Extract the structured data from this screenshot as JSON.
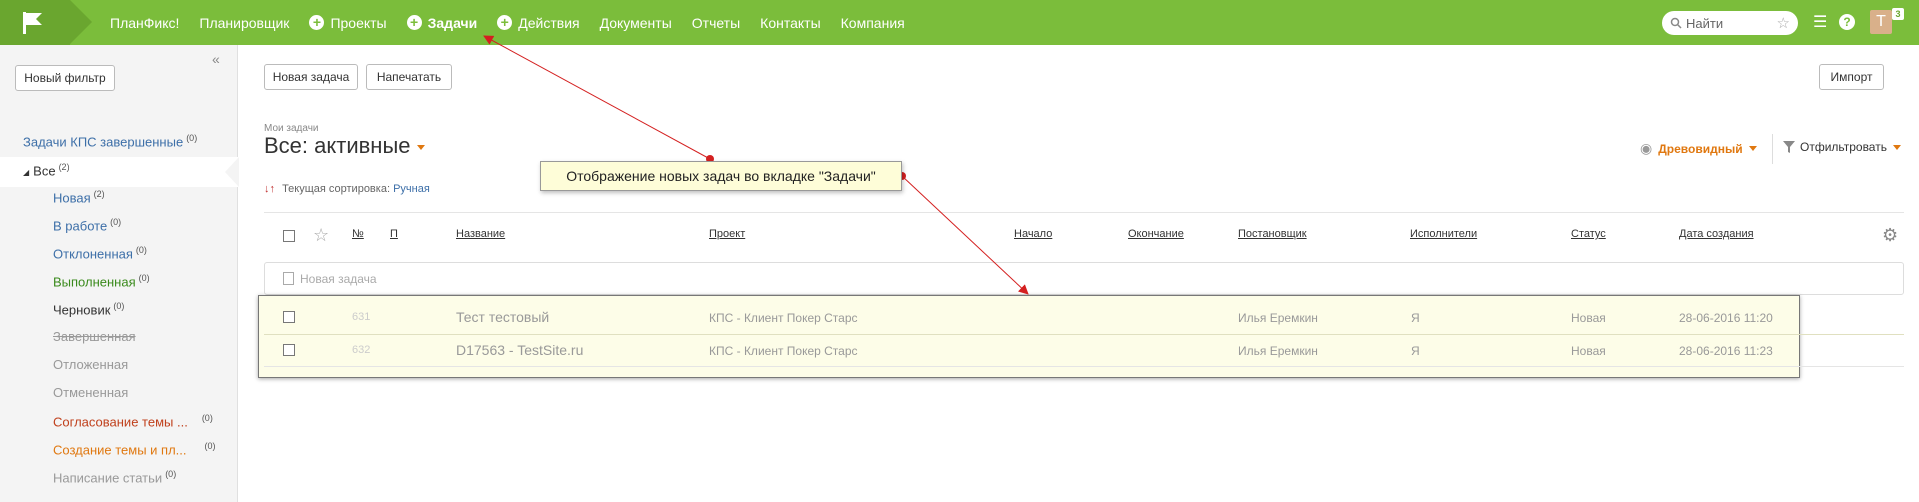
{
  "topbar": {
    "nav": [
      {
        "label": "ПланФикс!",
        "plus": false,
        "active": false
      },
      {
        "label": "Планировщик",
        "plus": false,
        "active": false
      },
      {
        "label": "Проекты",
        "plus": true,
        "active": false
      },
      {
        "label": "Задачи",
        "plus": true,
        "active": true
      },
      {
        "label": "Действия",
        "plus": true,
        "active": false
      },
      {
        "label": "Документы",
        "plus": false,
        "active": false
      },
      {
        "label": "Отчеты",
        "plus": false,
        "active": false
      },
      {
        "label": "Контакты",
        "plus": false,
        "active": false
      },
      {
        "label": "Компания",
        "plus": false,
        "active": false
      }
    ],
    "search_placeholder": "Найти",
    "avatar_letter": "T",
    "avatar_badge": "3",
    "help": "?"
  },
  "sidebar": {
    "new_filter": "Новый фильтр",
    "items": [
      {
        "label": "Задачи КПС завершенные",
        "count": "(0)"
      },
      {
        "label": "Все",
        "count": "(2)"
      },
      {
        "label": "Новая",
        "count": "(2)"
      },
      {
        "label": "В работе",
        "count": "(0)"
      },
      {
        "label": "Отклоненная",
        "count": "(0)"
      },
      {
        "label": "Выполненная",
        "count": "(0)"
      },
      {
        "label": "Черновик",
        "count": "(0)"
      },
      {
        "label": "Завершенная",
        "count": ""
      },
      {
        "label": "Отложенная",
        "count": ""
      },
      {
        "label": "Отмененная",
        "count": ""
      },
      {
        "label": "Согласование темы ...",
        "count": "(0)"
      },
      {
        "label": "Создание темы и пл...",
        "count": "(0)"
      },
      {
        "label": "Написание статьи",
        "count": "(0)"
      }
    ]
  },
  "toolbar": {
    "new_task": "Новая задача",
    "print": "Напечатать",
    "import": "Импорт"
  },
  "header": {
    "breadcrumb": "Мои задачи",
    "title": "Все: активные",
    "sort_label": "Текущая сортировка:",
    "sort_value": "Ручная",
    "view_mode": "Древовидный",
    "filter": "Отфильтровать"
  },
  "table": {
    "columns": [
      "№",
      "П",
      "Название",
      "Проект",
      "Начало",
      "Окончание",
      "Постановщик",
      "Исполнители",
      "Статус",
      "Дата создания"
    ],
    "new_task_placeholder": "Новая задача",
    "rows": [
      {
        "num": "631",
        "name": "Тест тестовый",
        "project": "КПС - Клиент Покер Старс",
        "assigner": "Илья Еремкин",
        "executors": "Я",
        "status": "Новая",
        "created": "28-06-2016 11:20"
      },
      {
        "num": "632",
        "name": "D17563 - TestSite.ru",
        "project": "КПС - Клиент Покер Старс",
        "assigner": "Илья Еремкин",
        "executors": "Я",
        "status": "Новая",
        "created": "28-06-2016 11:23"
      }
    ]
  },
  "annotation": {
    "text": "Отображение новых задач во вкладке \"Задачи\""
  },
  "colors": {
    "topbar": "#7bbd3b",
    "accent_orange": "#e07810",
    "link_blue": "#3d6fa8",
    "arrow_red": "#d42020"
  }
}
